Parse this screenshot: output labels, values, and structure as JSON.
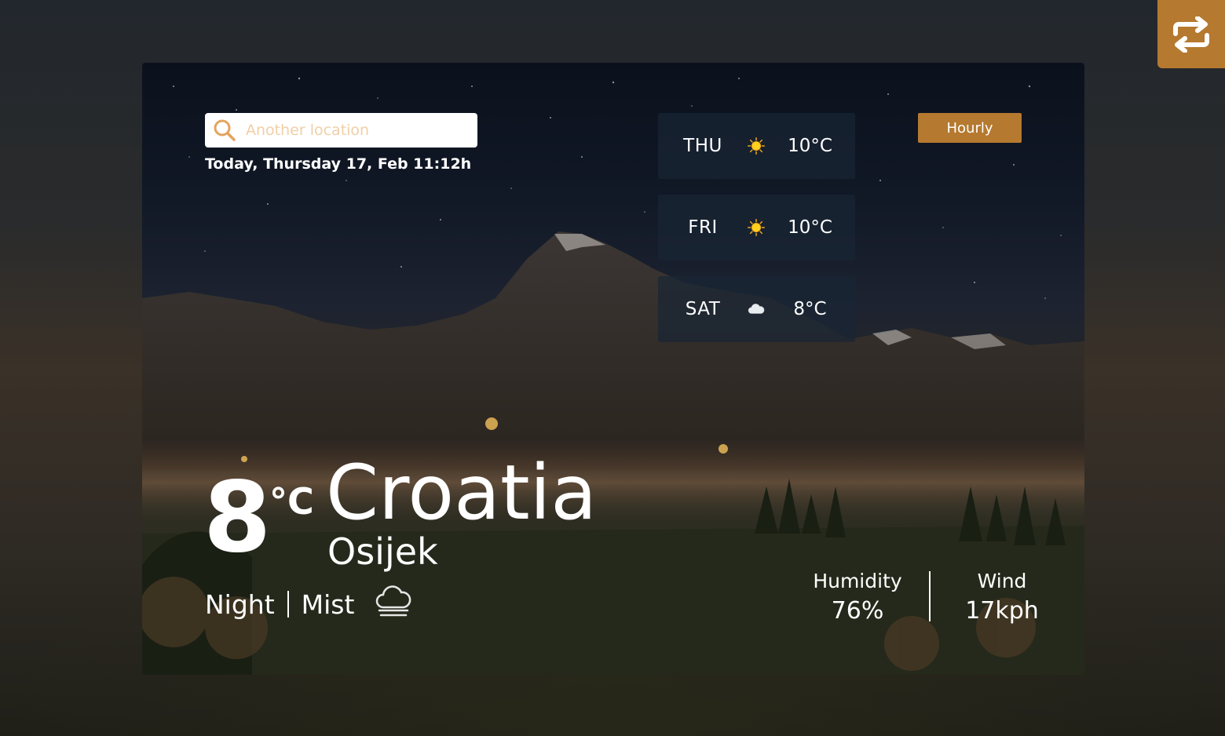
{
  "search": {
    "placeholder": "Another location"
  },
  "date_text": "Today, Thursday 17, Feb 11:12h",
  "hourly_label": "Hourly",
  "forecast": [
    {
      "day": "THU",
      "icon": "sun-icon",
      "temp": "10°C"
    },
    {
      "day": "FRI",
      "icon": "sun-icon",
      "temp": "10°C"
    },
    {
      "day": "SAT",
      "icon": "cloud-icon",
      "temp": "8°C"
    }
  ],
  "current": {
    "temp": "8",
    "unit": "°C",
    "country": "Croatia",
    "city": "Osijek",
    "time_of_day": "Night",
    "condition": "Mist",
    "condition_icon": "mist-icon"
  },
  "stats": {
    "humidity_label": "Humidity",
    "humidity_value": "76%",
    "wind_label": "Wind",
    "wind_value": "17kph"
  },
  "colors": {
    "accent": "#b5792f",
    "panel": "#192534",
    "placeholder": "#f0cfa6"
  }
}
